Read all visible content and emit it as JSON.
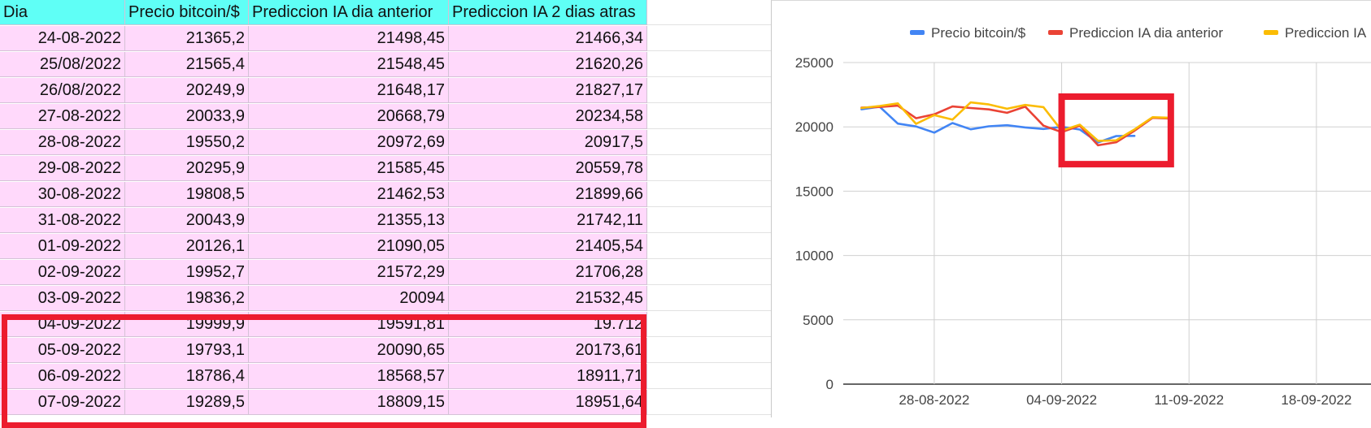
{
  "table": {
    "headers": [
      "Dia",
      "Precio bitcoin/$",
      "Prediccion IA dia anterior",
      "Prediccion IA 2 dias atras"
    ],
    "rows": [
      [
        "24-08-2022",
        "21365,2",
        "21498,45",
        "21466,34"
      ],
      [
        "25/08/2022",
        "21565,4",
        "21548,45",
        "21620,26"
      ],
      [
        "26/08/2022",
        "20249,9",
        "21648,17",
        "21827,17"
      ],
      [
        "27-08-2022",
        "20033,9",
        "20668,79",
        "20234,58"
      ],
      [
        "28-08-2022",
        "19550,2",
        "20972,69",
        "20917,5"
      ],
      [
        "29-08-2022",
        "20295,9",
        "21585,45",
        "20559,78"
      ],
      [
        "30-08-2022",
        "19808,5",
        "21462,53",
        "21899,66"
      ],
      [
        "31-08-2022",
        "20043,9",
        "21355,13",
        "21742,11"
      ],
      [
        "01-09-2022",
        "20126,1",
        "21090,05",
        "21405,54"
      ],
      [
        "02-09-2022",
        "19952,7",
        "21572,29",
        "21706,28"
      ],
      [
        "03-09-2022",
        "19836,2",
        "20094",
        "21532,45"
      ],
      [
        "04-09-2022",
        "19999,9",
        "19591,81",
        "19.712"
      ],
      [
        "05-09-2022",
        "19793,1",
        "20090,65",
        "20173,61"
      ],
      [
        "06-09-2022",
        "18786,4",
        "18568,57",
        "18911,71"
      ],
      [
        "07-09-2022",
        "19289,5",
        "18809,15",
        "18951,64"
      ]
    ]
  },
  "chart_data": {
    "type": "line",
    "x": [
      "2022-08-24",
      "2022-08-25",
      "2022-08-26",
      "2022-08-27",
      "2022-08-28",
      "2022-08-29",
      "2022-08-30",
      "2022-08-31",
      "2022-09-01",
      "2022-09-02",
      "2022-09-03",
      "2022-09-04",
      "2022-09-05",
      "2022-09-06",
      "2022-09-07",
      "2022-09-08",
      "2022-09-09",
      "2022-09-10"
    ],
    "series": [
      {
        "name": "Precio bitcoin/$",
        "color": "#4285f4",
        "values": [
          21365.2,
          21565.4,
          20249.9,
          20033.9,
          19550.2,
          20295.9,
          19808.5,
          20043.9,
          20126.1,
          19952.7,
          19836.2,
          19999.9,
          19793.1,
          18786.4,
          19289.5,
          19300,
          null,
          null
        ]
      },
      {
        "name": "Prediccion IA dia anterior",
        "color": "#ea4335",
        "values": [
          21498.45,
          21548.45,
          21648.17,
          20668.79,
          20972.69,
          21585.45,
          21462.53,
          21355.13,
          21090.05,
          21572.29,
          20094,
          19591.81,
          20090.65,
          18568.57,
          18809.15,
          19700,
          20700,
          20650
        ]
      },
      {
        "name": "Prediccion IA 2 dias atras",
        "color": "#fbbc04",
        "values": [
          21466.34,
          21620.26,
          21827.17,
          20234.58,
          20917.5,
          20559.78,
          21899.66,
          21742.11,
          21405.54,
          21706.28,
          21532.45,
          19712,
          20173.61,
          18911.71,
          18951.64,
          19800,
          20750,
          20700
        ]
      }
    ],
    "legend_labels": [
      "Precio bitcoin/$",
      "Prediccion IA dia anterior",
      "Prediccion IA"
    ],
    "legend_position": "top",
    "y_ticks": [
      "0",
      "5000",
      "10000",
      "15000",
      "20000",
      "25000"
    ],
    "ylim": [
      0,
      25000
    ],
    "x_ticks": [
      "28-08-2022",
      "04-09-2022",
      "11-09-2022",
      "18-09-2022"
    ],
    "x_tick_dates": [
      "2022-08-28",
      "2022-09-04",
      "2022-09-11",
      "2022-09-18"
    ],
    "xlim": [
      "2022-08-23",
      "2022-09-21"
    ],
    "grid": true,
    "highlight_box": {
      "x_range": [
        "2022-09-04",
        "2022-09-10"
      ],
      "y_range": [
        17100,
        22350
      ],
      "color": "#ec1c2e"
    }
  }
}
